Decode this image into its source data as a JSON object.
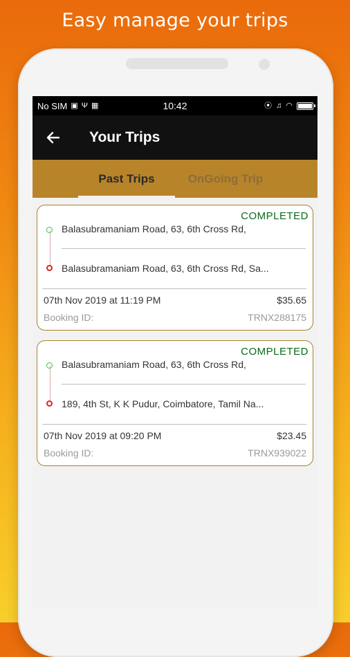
{
  "headline": "Easy manage your trips",
  "statusbar": {
    "carrier": "No SIM",
    "time": "10:42"
  },
  "appbar": {
    "title": "Your Trips",
    "back_icon": "arrow-left-icon"
  },
  "tabs": [
    {
      "label": "Past Trips",
      "active": true
    },
    {
      "label": "OnGoing Trip",
      "active": false
    }
  ],
  "trips": [
    {
      "status": "COMPLETED",
      "from": "Balasubramaniam Road, 63, 6th Cross Rd,",
      "to": "Balasubramaniam Road, 63, 6th Cross Rd, Sa...",
      "date": "07th Nov 2019 at 11:19 PM",
      "amount": "$35.65",
      "booking_label": "Booking ID:",
      "booking_id": "TRNX288175"
    },
    {
      "status": "COMPLETED",
      "from": "Balasubramaniam Road, 63, 6th Cross Rd,",
      "to": "189, 4th St, K K Pudur, Coimbatore, Tamil Na...",
      "date": "07th Nov 2019 at 09:20 PM",
      "amount": "$23.45",
      "booking_label": "Booking ID:",
      "booking_id": "TRNX939022"
    }
  ],
  "colors": {
    "tab_bar": "#b8842a",
    "completed": "#0a6b1a",
    "card_border": "#a8822e"
  }
}
